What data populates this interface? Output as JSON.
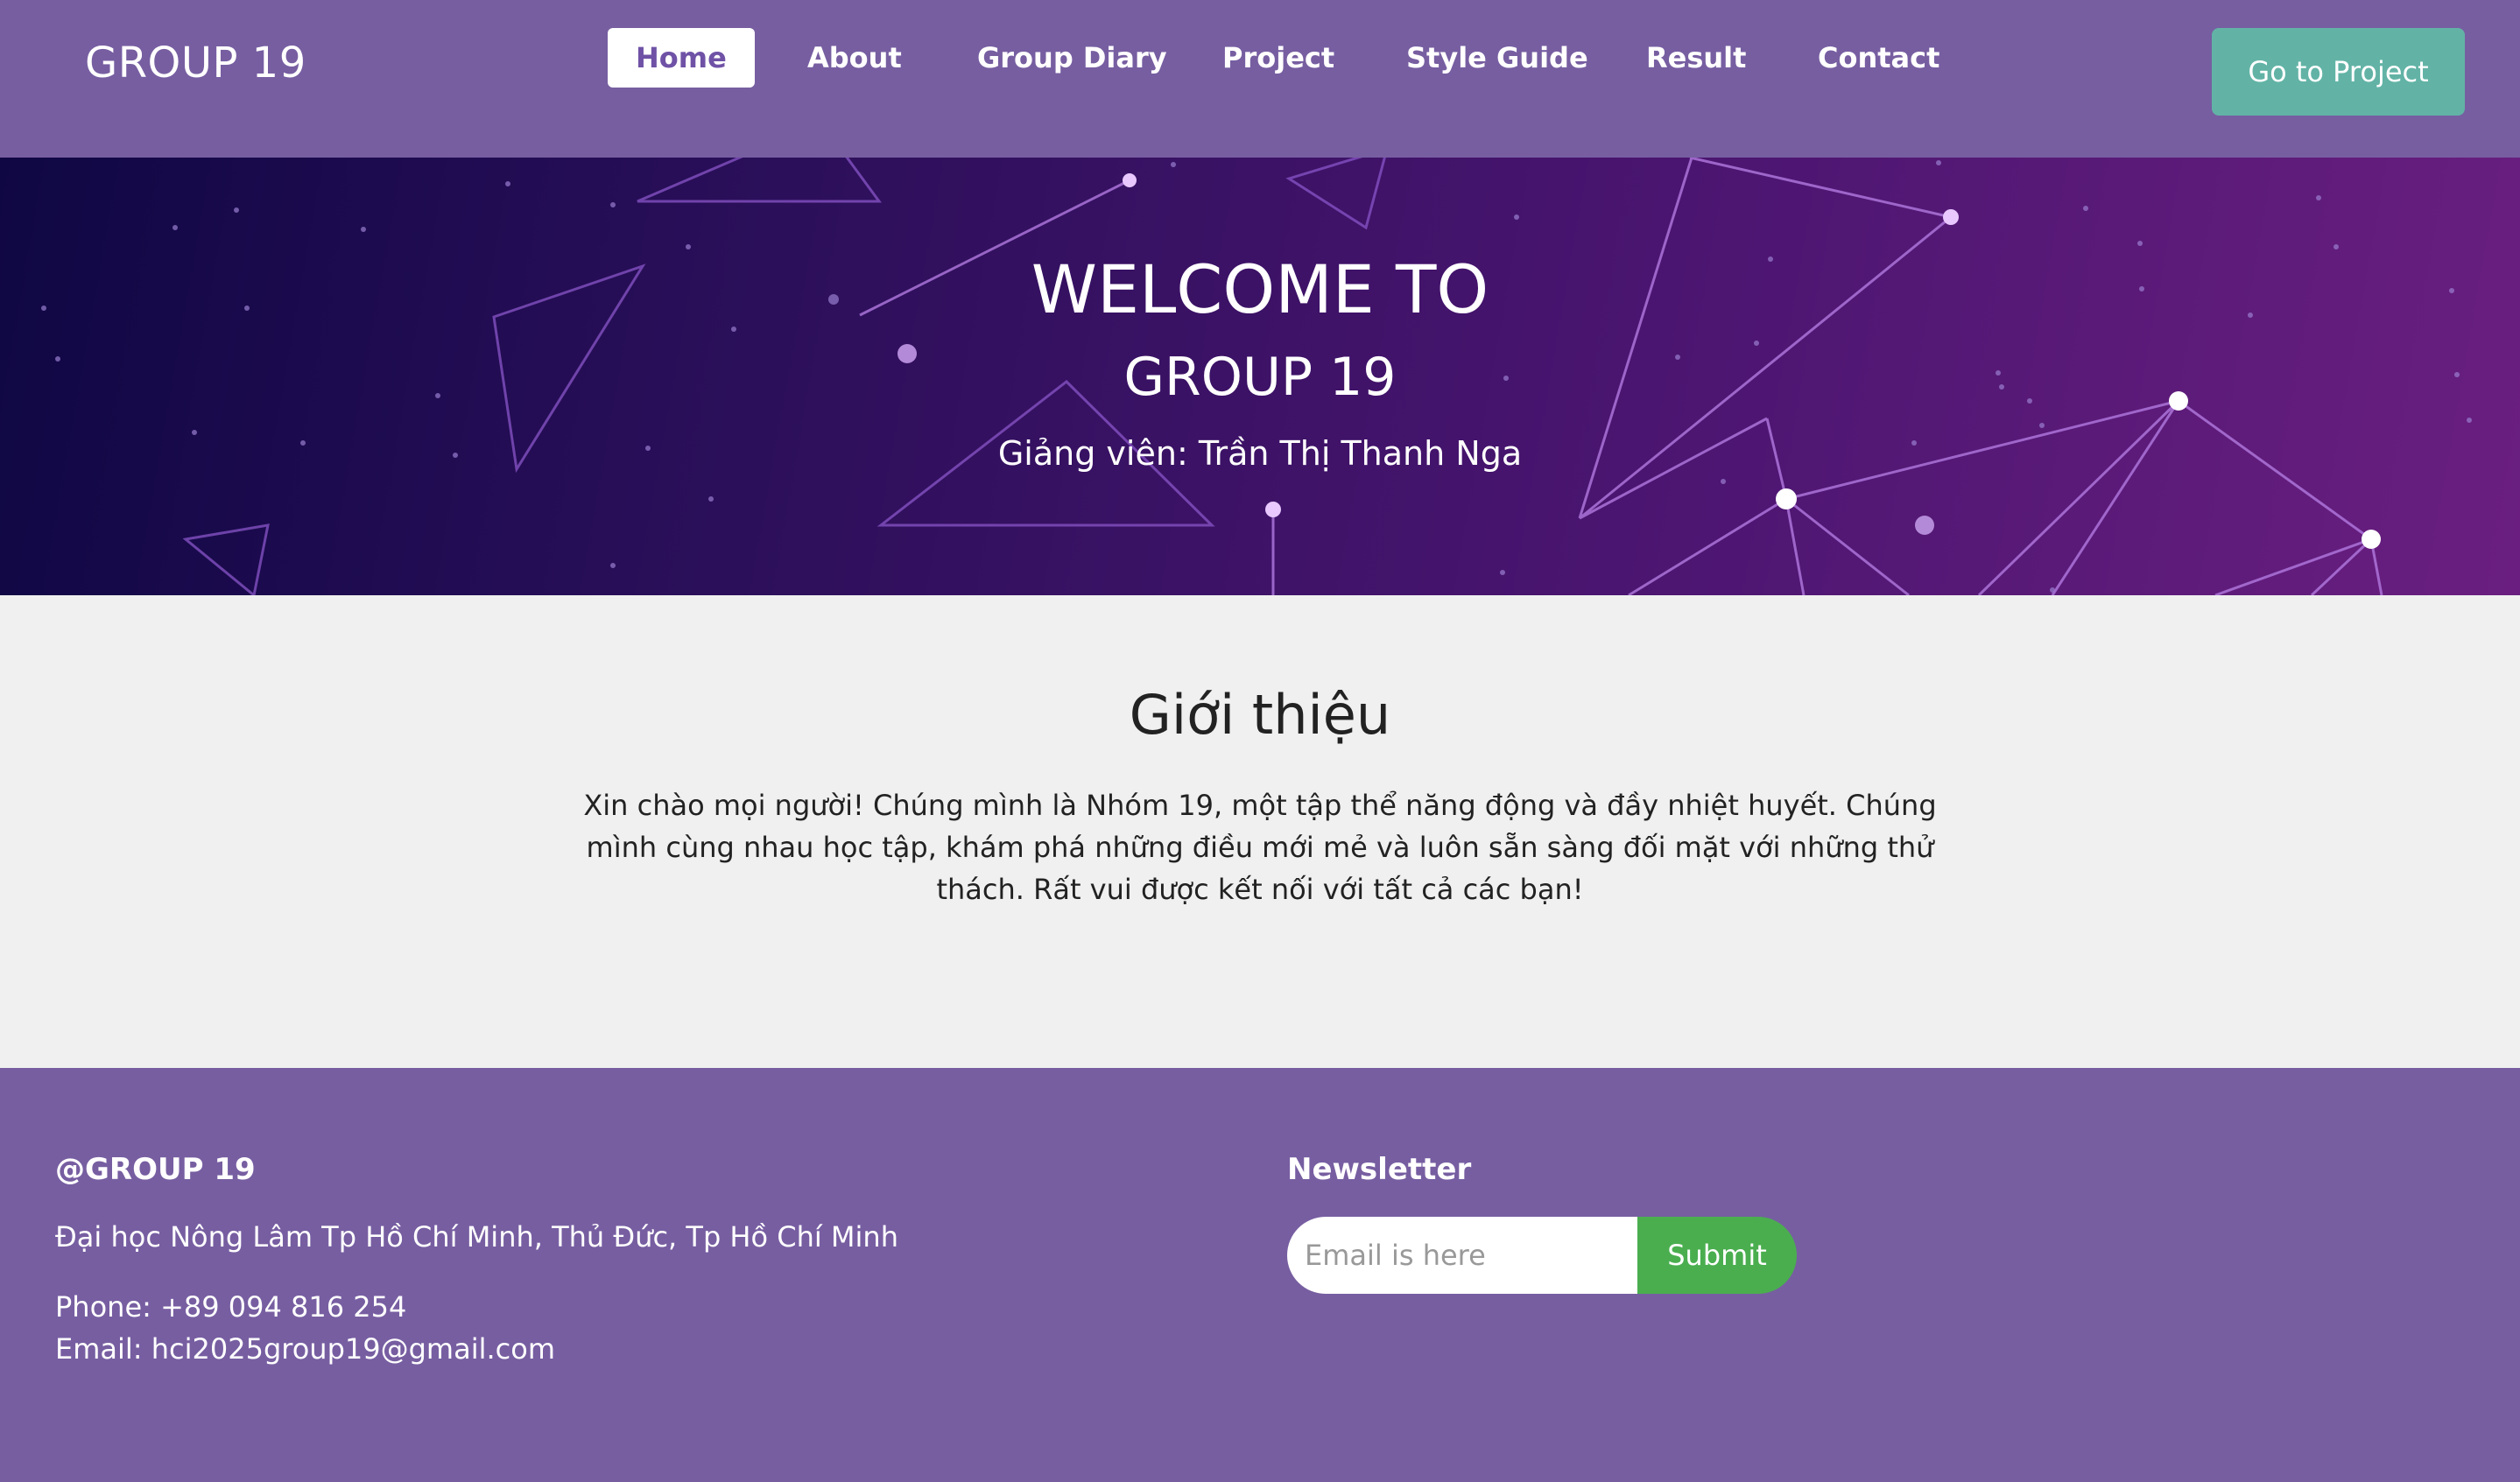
{
  "header": {
    "brand": "GROUP 19",
    "nav": [
      {
        "label": "Home",
        "active": true
      },
      {
        "label": "About"
      },
      {
        "label": "Group Diary"
      },
      {
        "label": "Project"
      },
      {
        "label": "Style Guide"
      },
      {
        "label": "Result"
      },
      {
        "label": "Contact"
      }
    ],
    "cta_label": "Go to Project"
  },
  "hero": {
    "line1": "WELCOME TO",
    "line2": "GROUP 19",
    "line3": "Giảng viên: Trần Thị Thanh Nga"
  },
  "intro": {
    "heading": "Giới thiệu",
    "paragraph": "Xin chào mọi người! Chúng mình là Nhóm 19, một tập thể năng động và đầy nhiệt huyết. Chúng mình cùng nhau học tập, khám phá những điều mới mẻ và luôn sẵn sàng đối mặt với những thử thách. Rất vui được kết nối với tất cả các bạn!"
  },
  "footer": {
    "brand": "@GROUP 19",
    "address": "Đại học Nông Lâm Tp Hồ Chí Minh, Thủ Đức, Tp Hồ Chí Minh",
    "phone": "Phone: +89 094 816 254",
    "email": "Email: hci2025group19@gmail.com",
    "newsletter_title": "Newsletter",
    "email_placeholder": "Email is here",
    "submit_label": "Submit"
  },
  "colors": {
    "header_bg": "#775ea1",
    "cta_bg": "#62b3a6",
    "submit_bg": "#4aae4f",
    "page_bg": "#f0f0f0"
  }
}
